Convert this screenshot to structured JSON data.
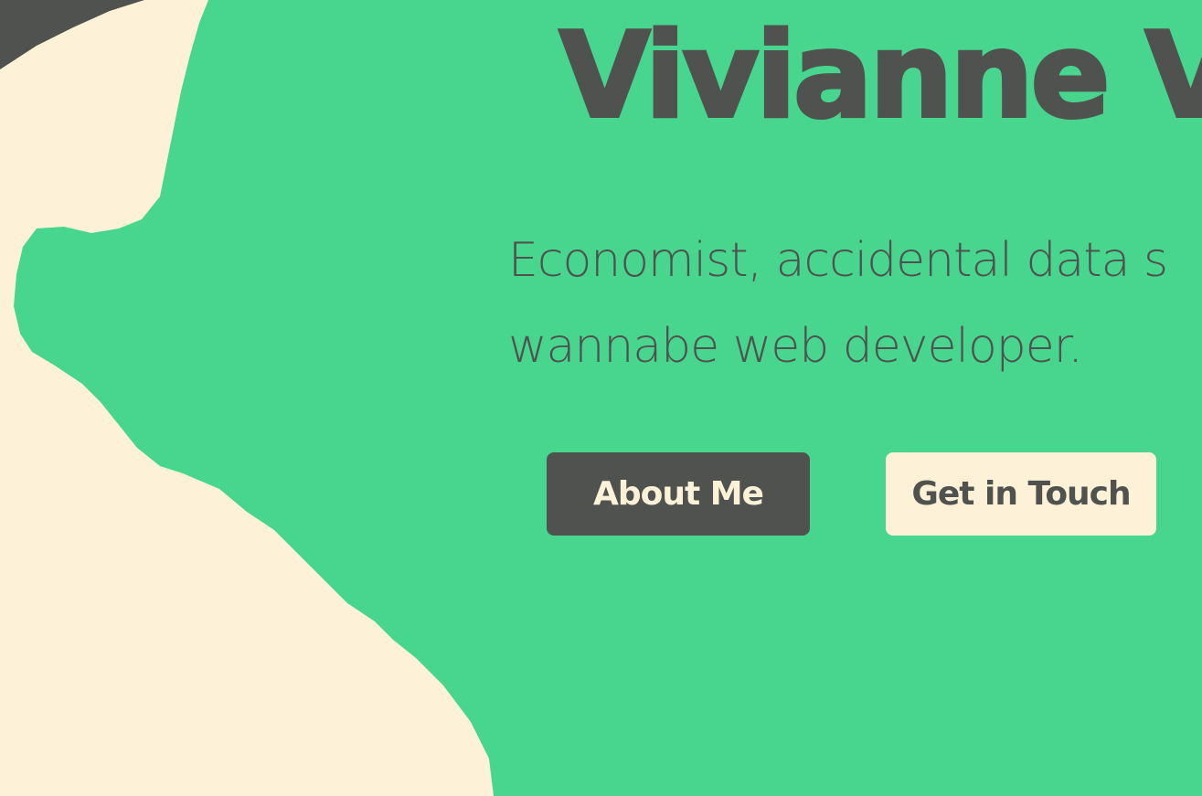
{
  "hero": {
    "title": "Vivianne V",
    "subtitle": "Economist, accidental data s wannabe web developer."
  },
  "actions": {
    "about_label": "About Me",
    "contact_label": "Get in Touch"
  },
  "colors": {
    "green": "#48D68E",
    "cream": "#FDF2D8",
    "charcoal": "#4F524F"
  }
}
